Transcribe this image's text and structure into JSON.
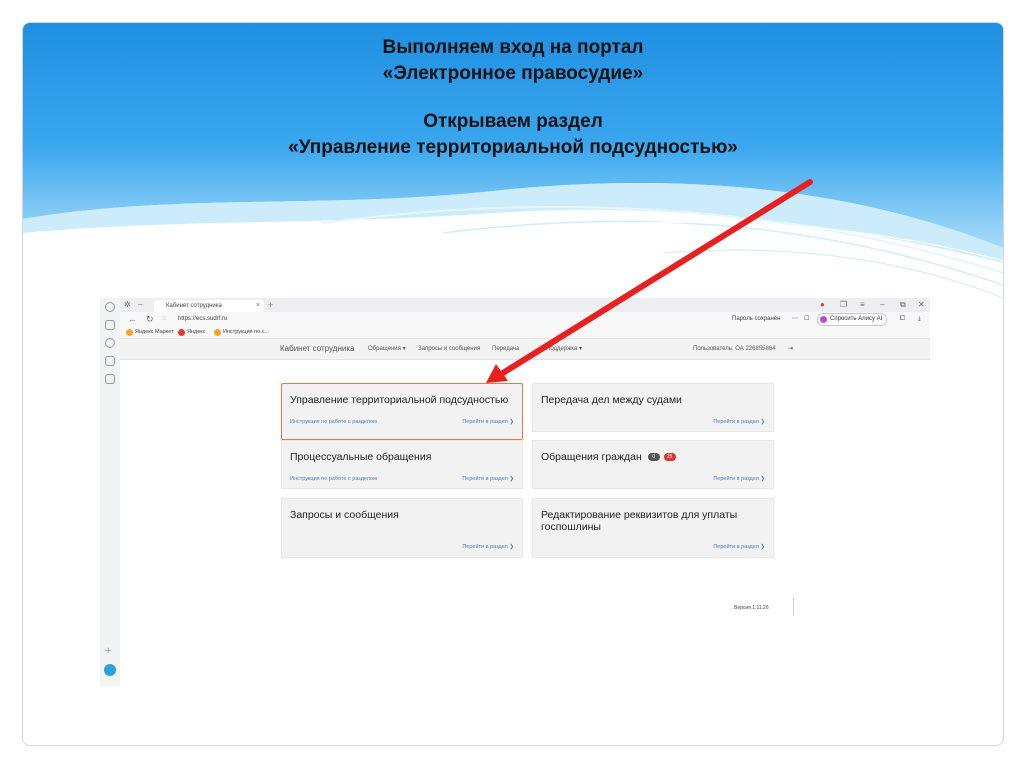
{
  "slide": {
    "title_lines": [
      "Выполняем вход на портал",
      "«Электронное правосудие»",
      "Открываем раздел",
      "«Управление территориальной подсудностью»"
    ]
  },
  "browser": {
    "tab_title": "Кабинет сотрудника",
    "tab_close": "×",
    "new_tab": "+",
    "url": "https://ecs.sudrf.ru",
    "password_saved": "Пароль сохранён",
    "alice_button": "Спросить Алису AI",
    "bookmarks": [
      "Яндекс Маркет",
      "Яндекс",
      "Инструкция по с..."
    ]
  },
  "app": {
    "logo": "Кабинет сотрудника",
    "menu": [
      "Обращения ▾",
      "Запросы и сообщения",
      "Передача",
      "Поддержка ▾"
    ],
    "user": "Пользователь: ОА 226855864"
  },
  "cards": [
    {
      "title": "Управление территориальной подсудностью",
      "link_left": "Инструкция по работе с разделом",
      "link_right": "Перейти в раздел ❯"
    },
    {
      "title": "Передача дел между судами",
      "link_left": "",
      "link_right": "Перейти в раздел ❯"
    },
    {
      "title": "Процессуальные обращения",
      "link_left": "Инструкция по работе с разделом",
      "link_right": "Перейти в раздел ❯"
    },
    {
      "title": "Обращения граждан",
      "badges": [
        "0",
        "25"
      ],
      "link_left": "",
      "link_right": "Перейти в раздел ❯"
    },
    {
      "title": "Запросы и сообщения",
      "link_left": "",
      "link_right": "Перейти в раздел ❯"
    },
    {
      "title": "Редактирование реквизитов для уплаты госпошлины",
      "link_left": "",
      "link_right": "Перейти в раздел ❯"
    }
  ],
  "footer": {
    "version": "Версия 1.11.26"
  },
  "colors": {
    "banner_blue": "#2a97e6",
    "arrow_red": "#e82020",
    "highlight_orange": "#e8793b",
    "link_blue": "#4a7fc1"
  }
}
